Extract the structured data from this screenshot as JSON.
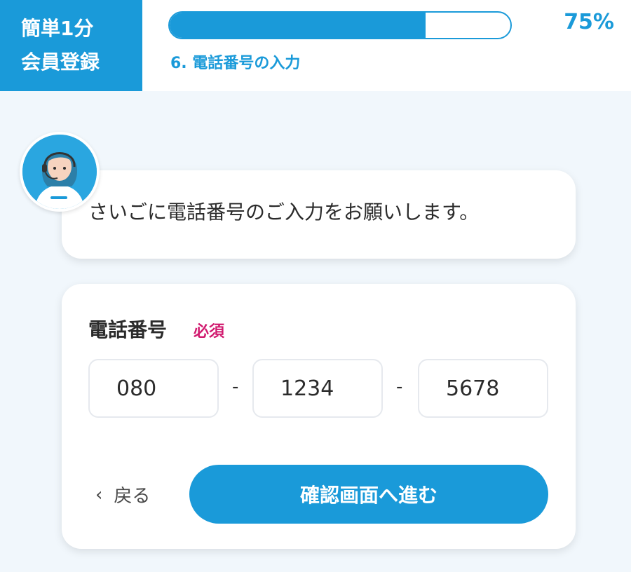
{
  "header": {
    "brand_line1": "簡単1分",
    "brand_line2": "会員登録",
    "progress_percent_text": "75%",
    "progress_fraction": 0.75,
    "step_label": "6. 電話番号の入力"
  },
  "chat": {
    "avatar_icon": "operator-avatar-icon",
    "message": "さいごに電話番号のご入力をお願いします。"
  },
  "form": {
    "field_label": "電話番号",
    "required_badge": "必須",
    "phone_part1": "080",
    "phone_part2": "1234",
    "phone_part3": "5678",
    "separator": "-",
    "back_label": "戻る",
    "submit_label": "確認画面へ進む"
  },
  "colors": {
    "accent": "#1a9ad9",
    "required": "#d11a6f",
    "background": "#f1f7fc"
  }
}
